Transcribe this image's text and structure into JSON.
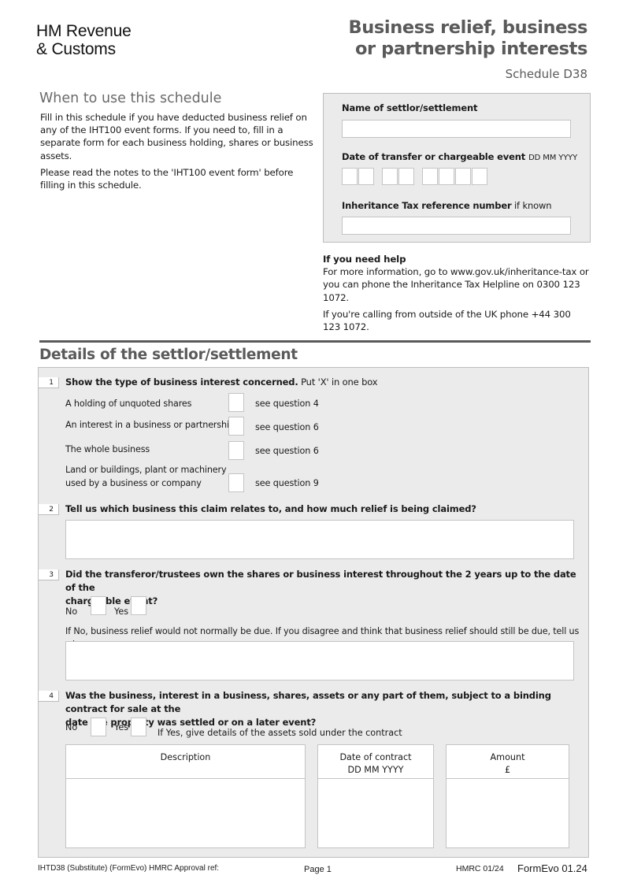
{
  "header": {
    "logo_line1": "HM Revenue",
    "logo_line2": "& Customs",
    "title_line1": "Business relief, business",
    "title_line2": "or partnership interests",
    "schedule": "Schedule D38"
  },
  "when_to_use": {
    "title": "When to use this schedule",
    "para1": "Fill in this schedule if you have deducted business relief on any of the IHT100 event forms. If you need to, fill in a separate form for each business holding, shares or business assets.",
    "para2": "Please read the notes to the 'IHT100 event form' before filling in this schedule."
  },
  "settlor_panel": {
    "name_label": "Name of settlor/settlement",
    "name_value": "",
    "date_label": "Date of transfer or chargeable event",
    "date_format": "DD MM YYYY",
    "ref_label": "Inheritance Tax reference number",
    "ref_suffix": "if known",
    "ref_value": ""
  },
  "help": {
    "title": "If you need help",
    "para1": "For more information, go to www.gov.uk/inheritance-tax or you can phone the Inheritance Tax Helpline on 0300 123 1072.",
    "para2": "If you're calling from outside of the UK phone +44 300 123 1072."
  },
  "details": {
    "title": "Details of the settlor/settlement",
    "q1": {
      "number": "1",
      "bold": "Show the type of business interest concerned.",
      "rest": " Put 'X' in one box",
      "options": [
        {
          "label": "A holding of unquoted shares",
          "see": "see question 4"
        },
        {
          "label": "An interest in a business or partnership",
          "see": "see question 6"
        },
        {
          "label": "The whole business",
          "see": "see question 6"
        },
        {
          "label_line1": "Land or buildings, plant or machinery",
          "label_line2": "used by a business or company",
          "see": "see question 9"
        }
      ]
    },
    "q2": {
      "number": "2",
      "text": "Tell us which business this claim relates to, and how much relief is being claimed?"
    },
    "q3": {
      "number": "3",
      "text_line1": "Did the transferor/trustees own the shares or business interest throughout the 2 years up to the date of the",
      "text_line2": "chargeable event?",
      "no": "No",
      "yes": "Yes",
      "note": "If No, business relief would not normally be due. If you disagree and think that business relief should still be due, tell us why"
    },
    "q4": {
      "number": "4",
      "text_line1": "Was the business, interest in a business, shares, assets or any part of them, subject to a binding contract for sale at the",
      "text_line2": "date the property was settled or on a later event?",
      "no": "No",
      "yes": "Yes",
      "note": "If Yes, give details of the assets sold under the contract",
      "columns": [
        {
          "line1": "Description",
          "line2": ""
        },
        {
          "line1": "Date of contract",
          "line2": "DD MM YYYY"
        },
        {
          "line1": "Amount",
          "line2": "£"
        }
      ]
    }
  },
  "footer": {
    "left": "IHTD38  (Substitute) (FormEvo) HMRC Approval ref:",
    "center": "Page 1",
    "right1": "HMRC 01/24",
    "right2": "FormEvo 01.24"
  }
}
